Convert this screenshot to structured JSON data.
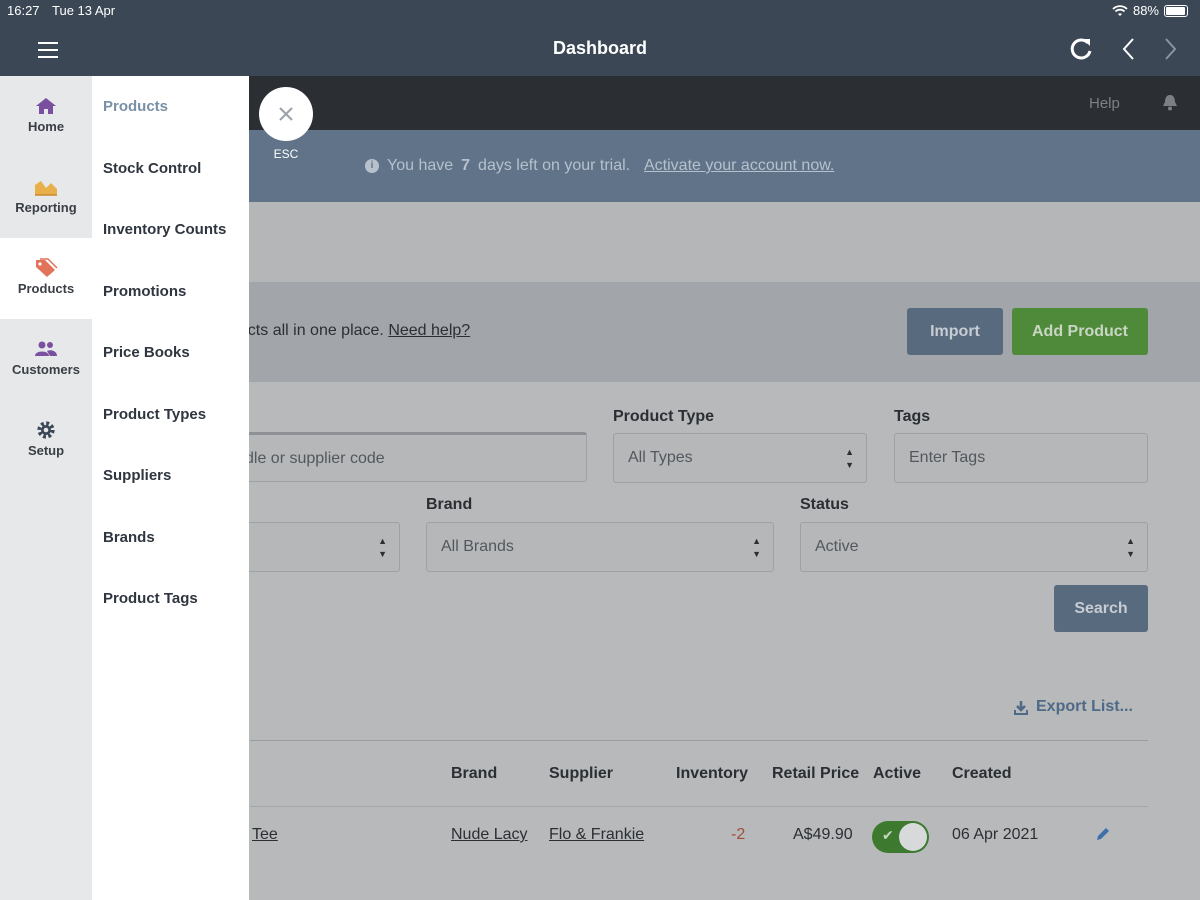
{
  "status_bar": {
    "time": "16:27",
    "date": "Tue 13 Apr",
    "battery": "88%"
  },
  "app_bar": {
    "title": "Dashboard"
  },
  "top_nav": {
    "help": "Help"
  },
  "banner": {
    "text_before": "You have",
    "days": "7",
    "text_after": "days left on your trial.",
    "link": "Activate your account now."
  },
  "intro": {
    "text": "ducts all in one place.",
    "link": "Need help?"
  },
  "actions": {
    "import": "Import",
    "add_product": "Add Product"
  },
  "filters": {
    "search_placeholder": "dle or supplier code",
    "product_type": {
      "label": "Product Type",
      "value": "All Types"
    },
    "tags": {
      "label": "Tags",
      "placeholder": "Enter Tags"
    },
    "brand": {
      "label": "Brand",
      "value": "All Brands"
    },
    "status": {
      "label": "Status",
      "value": "Active"
    },
    "search_button": "Search"
  },
  "list": {
    "export": "Export List...",
    "columns": [
      "Brand",
      "Supplier",
      "Inventory",
      "Retail Price",
      "Active",
      "Created"
    ],
    "rows": [
      {
        "name": "Tee",
        "brand": "Nude Lacy",
        "supplier": "Flo & Frankie",
        "inventory": "-2",
        "price": "A$49.90",
        "active": true,
        "created": "06 Apr 2021"
      }
    ]
  },
  "sidebar": {
    "rail": [
      {
        "label": "Home",
        "icon": "home-icon"
      },
      {
        "label": "Reporting",
        "icon": "chart-icon"
      },
      {
        "label": "Products",
        "icon": "tag-icon",
        "active": true
      },
      {
        "label": "Customers",
        "icon": "people-icon"
      },
      {
        "label": "Setup",
        "icon": "gear-icon"
      }
    ],
    "submenu": [
      "Products",
      "Stock Control",
      "Inventory Counts",
      "Promotions",
      "Price Books",
      "Product Types",
      "Suppliers",
      "Brands",
      "Product Tags"
    ],
    "esc_label": "ESC"
  },
  "colors": {
    "header": "#3b4754",
    "accent_green": "#4f8a3a",
    "rail_active_icon": "#e0735a",
    "rail_icon": "#7b4fa0"
  }
}
